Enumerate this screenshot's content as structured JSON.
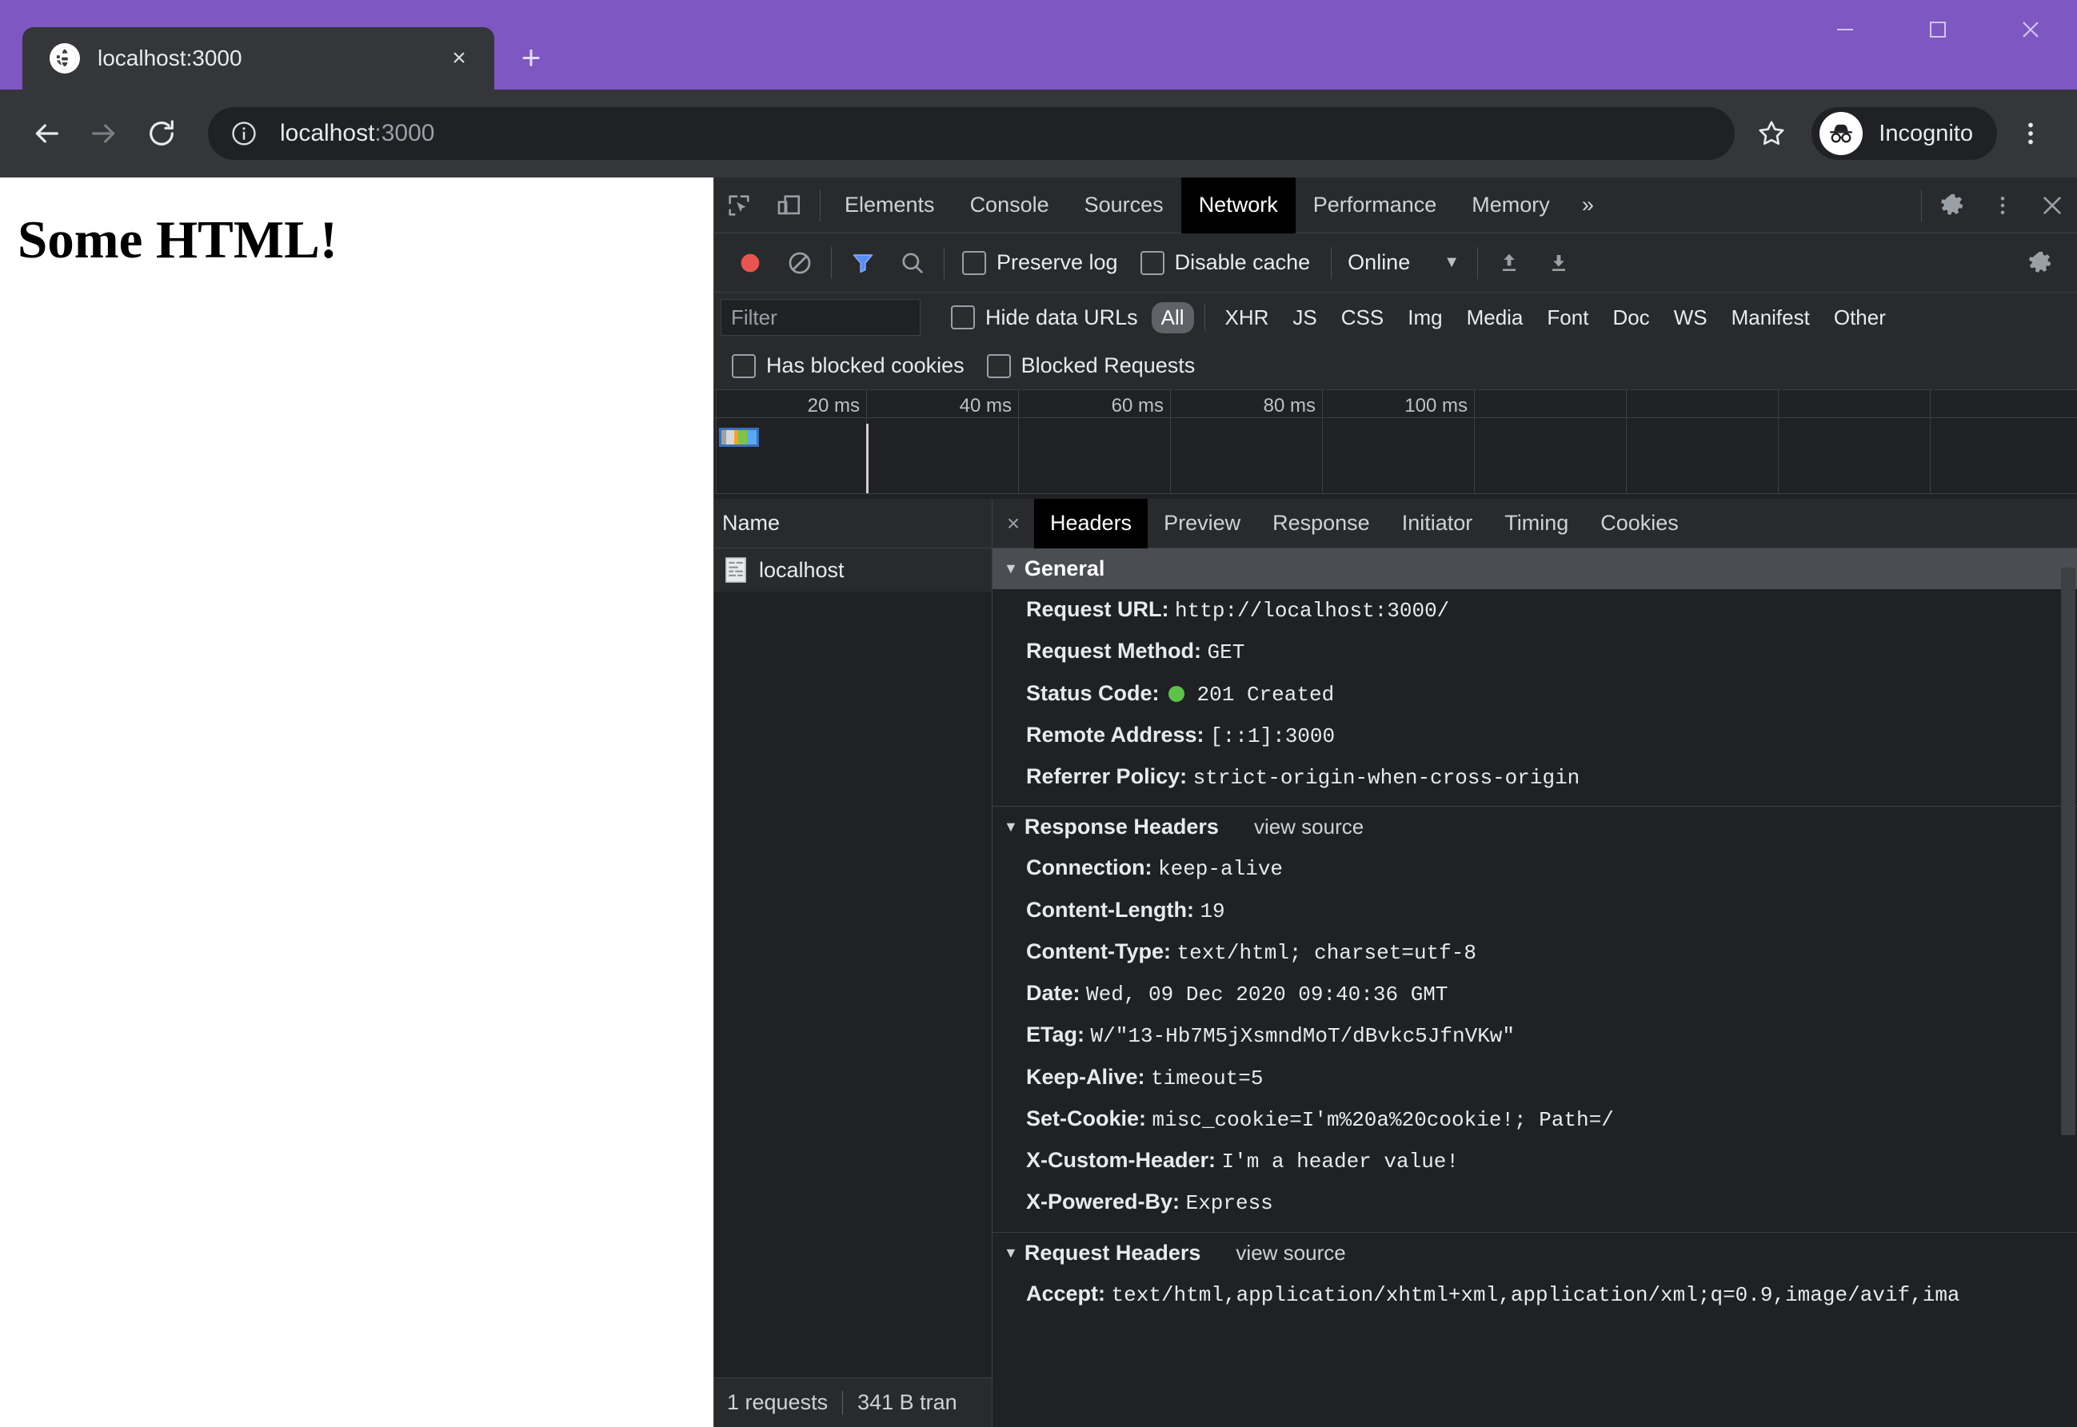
{
  "browser": {
    "tab": {
      "title": "localhost:3000",
      "favicon": "globe-icon",
      "close": "×"
    },
    "new_tab_label": "+",
    "window_controls": {
      "minimize": "minimize-icon",
      "maximize": "maximize-icon",
      "close": "close-icon"
    },
    "omnibox": {
      "host": "localhost",
      "path": ":3000",
      "info_icon": "info-circle-icon"
    },
    "profile": {
      "label": "Incognito",
      "icon": "incognito-icon"
    },
    "nav": {
      "back": "back-arrow-icon",
      "forward": "forward-arrow-icon",
      "reload": "reload-icon"
    },
    "bookmark_icon": "star-icon",
    "menu_icon": "kebab-menu-icon"
  },
  "page": {
    "heading": "Some HTML!"
  },
  "devtools": {
    "panel_tabs": [
      {
        "label": "Elements",
        "active": false
      },
      {
        "label": "Console",
        "active": false
      },
      {
        "label": "Sources",
        "active": false
      },
      {
        "label": "Network",
        "active": true
      },
      {
        "label": "Performance",
        "active": false
      },
      {
        "label": "Memory",
        "active": false
      }
    ],
    "more_panels": "»",
    "inspect_icon": "inspect-element-icon",
    "device_icon": "device-toolbar-icon",
    "settings_icon": "gear-icon",
    "kebab_icon": "kebab-menu-icon",
    "close_icon": "close-icon",
    "network_toolbar": {
      "record_icon": "record-stop-icon",
      "clear_icon": "clear-icon",
      "filter_icon": "filter-funnel-icon",
      "search_icon": "search-icon",
      "preserve_log": "Preserve log",
      "disable_cache": "Disable cache",
      "throttle_value": "Online",
      "throttle_arrow": "▼",
      "import_icon": "import-har-icon",
      "export_icon": "export-har-icon",
      "settings_icon": "gear-icon"
    },
    "filter_bar": {
      "filter_placeholder": "Filter",
      "hide_data_urls": "Hide data URLs",
      "types": [
        {
          "label": "All",
          "active": true
        },
        {
          "label": "XHR",
          "active": false
        },
        {
          "label": "JS",
          "active": false
        },
        {
          "label": "CSS",
          "active": false
        },
        {
          "label": "Img",
          "active": false
        },
        {
          "label": "Media",
          "active": false
        },
        {
          "label": "Font",
          "active": false
        },
        {
          "label": "Doc",
          "active": false
        },
        {
          "label": "WS",
          "active": false
        },
        {
          "label": "Manifest",
          "active": false
        },
        {
          "label": "Other",
          "active": false
        }
      ],
      "has_blocked_cookies": "Has blocked cookies",
      "blocked_requests": "Blocked Requests"
    },
    "overview": {
      "ticks": [
        "20 ms",
        "40 ms",
        "60 ms",
        "80 ms",
        "100 ms"
      ]
    },
    "requests": {
      "column_header": "Name",
      "rows": [
        {
          "name": "localhost",
          "icon": "document-icon"
        }
      ]
    },
    "status_bar": {
      "requests": "1 requests",
      "transferred": "341 B tran"
    },
    "detail_tabs": [
      {
        "label": "Headers",
        "active": true
      },
      {
        "label": "Preview",
        "active": false
      },
      {
        "label": "Response",
        "active": false
      },
      {
        "label": "Initiator",
        "active": false
      },
      {
        "label": "Timing",
        "active": false
      },
      {
        "label": "Cookies",
        "active": false
      }
    ],
    "detail_close": "×",
    "sections": {
      "general": {
        "title": "General",
        "rows": [
          {
            "key": "Request URL:",
            "value": "http://localhost:3000/"
          },
          {
            "key": "Request Method:",
            "value": "GET"
          },
          {
            "key": "Status Code:",
            "value": "201 Created",
            "dot": true
          },
          {
            "key": "Remote Address:",
            "value": "[::1]:3000"
          },
          {
            "key": "Referrer Policy:",
            "value": "strict-origin-when-cross-origin"
          }
        ]
      },
      "response_headers": {
        "title": "Response Headers",
        "view_source": "view source",
        "rows": [
          {
            "key": "Connection:",
            "value": "keep-alive"
          },
          {
            "key": "Content-Length:",
            "value": "19"
          },
          {
            "key": "Content-Type:",
            "value": "text/html; charset=utf-8"
          },
          {
            "key": "Date:",
            "value": "Wed, 09 Dec 2020 09:40:36 GMT"
          },
          {
            "key": "ETag:",
            "value": "W/\"13-Hb7M5jXsmndMoT/dBvkc5JfnVKw\""
          },
          {
            "key": "Keep-Alive:",
            "value": "timeout=5"
          },
          {
            "key": "Set-Cookie:",
            "value": "misc_cookie=I'm%20a%20cookie!; Path=/"
          },
          {
            "key": "X-Custom-Header:",
            "value": "I'm a header value!"
          },
          {
            "key": "X-Powered-By:",
            "value": "Express"
          }
        ]
      },
      "request_headers": {
        "title": "Request Headers",
        "view_source": "view source",
        "rows": [
          {
            "key": "Accept:",
            "value": "text/html,application/xhtml+xml,application/xml;q=0.9,image/avif,ima"
          }
        ]
      }
    },
    "colors": {
      "accent_purple": "#7e57c2",
      "status_green": "#5ec24a",
      "record_red": "#e8554e",
      "filter_blue": "#5b8df0",
      "panel_bg": "#202124",
      "toolbar_bg": "#292a2d"
    }
  }
}
